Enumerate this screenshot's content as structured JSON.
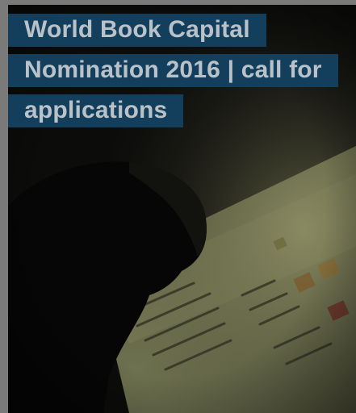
{
  "article": {
    "title": "World Book Capital Nomination 2016 | call for applications"
  },
  "image": {
    "subject": "person-reading-book-image"
  },
  "colors": {
    "page_background": "#7a7a7a",
    "title_background": "#133f5c",
    "title_text": "#b9c2c8"
  }
}
